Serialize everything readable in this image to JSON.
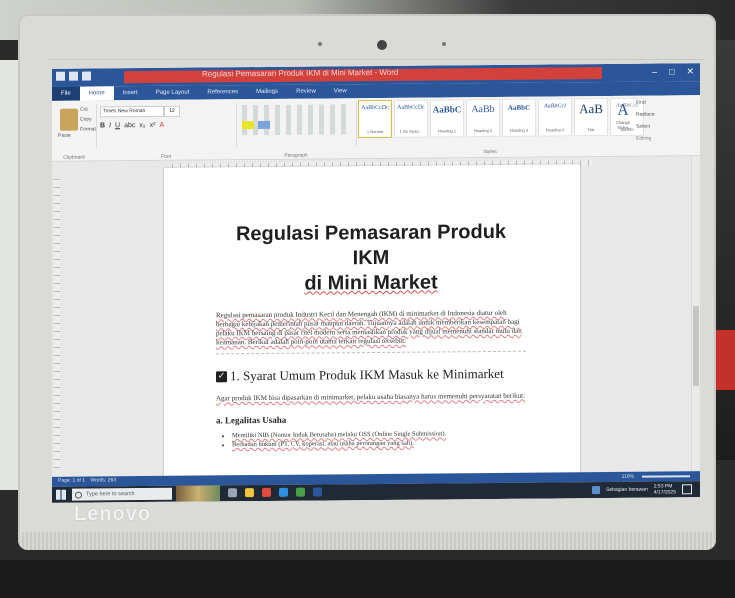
{
  "window": {
    "doc_title": "Regulasi Pemasaran Produk IKM di Mini Market - Word",
    "controls": {
      "minimize": "–",
      "maximize": "□",
      "close": "✕"
    }
  },
  "ribbon": {
    "tabs": [
      "File",
      "Home",
      "Insert",
      "Page Layout",
      "References",
      "Mailings",
      "Review",
      "View"
    ],
    "active_tab": "Home",
    "clipboard": {
      "paste": "Paste",
      "cut": "Cut",
      "copy": "Copy",
      "format_painter": "Format Painter",
      "label": "Clipboard"
    },
    "font": {
      "name": "Times New Roman",
      "size": "12",
      "label": "Font"
    },
    "paragraph_label": "Paragraph",
    "styles": [
      {
        "sample": "AaBbCcDc",
        "name": "1 Normal"
      },
      {
        "sample": "AaBbCcDc",
        "name": "1 No Spaci..."
      },
      {
        "sample": "AaBbC",
        "name": "Heading 1"
      },
      {
        "sample": "AaBb",
        "name": "Heading 2"
      },
      {
        "sample": "AaBbC",
        "name": "Heading 3"
      },
      {
        "sample": "AaBbCcI",
        "name": "Heading 4"
      },
      {
        "sample": "AaB",
        "name": "Title"
      },
      {
        "sample": "AaBbCcI",
        "name": "Subtitle"
      }
    ],
    "styles_label": "Styles",
    "change_styles": "Change Styles",
    "editing": {
      "find": "Find",
      "replace": "Replace",
      "select": "Select",
      "label": "Editing"
    }
  },
  "document": {
    "title_line1": "Regulasi Pemasaran Produk IKM",
    "title_line2": "di Mini Market",
    "intro": "Regulasi pemasaran produk Industri Kecil dan Menengah (IKM) di minimarket di Indonesia diatur oleh berbagai kebijakan pemerintah pusat maupun daerah. Tujuannya adalah untuk memberikan kesempatan bagi pelaku IKM bersaing di pasar ritel modern serta memastikan produk yang dijual memenuhi standar mutu dan keamanan. Berikut adalah poin-poin utama terkait regulasi tersebut:",
    "section1_title": "1. Syarat Umum Produk IKM Masuk ke Minimarket",
    "section1_intro": "Agar produk IKM bisa dipasarkan di minimarket, pelaku usaha biasanya harus memenuhi persyaratan berikut:",
    "subsection_a": "a. Legalitas Usaha",
    "bullets": [
      "Memiliki NIB (Nomor Induk Berusaha) melalui OSS (Online Single Submission).",
      "Berbadan hukum (PT, CV, koperasi, atau usaha perorangan yang sah)."
    ]
  },
  "status": {
    "page": "Page: 1 of 1",
    "words": "Words: 263",
    "zoom": "110%"
  },
  "taskbar": {
    "search_placeholder": "Type here to search",
    "weather": "Sebagian berawan",
    "time": "2:53 PM",
    "date": "4/17/2025"
  },
  "brand": "Lenovo",
  "colors": {
    "word_blue": "#2b579a",
    "title_highlight": "#d3413c",
    "taskbar": "#1f2a36"
  }
}
